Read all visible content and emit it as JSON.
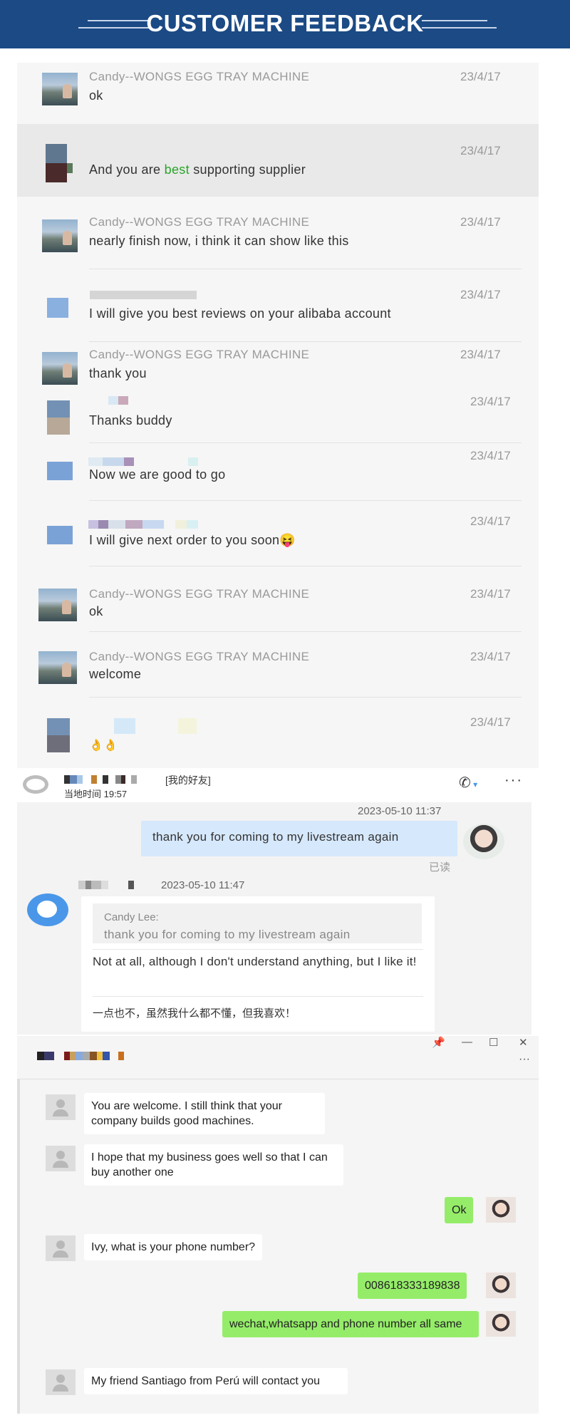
{
  "banner": {
    "title": "CUSTOMER FEEDBACK"
  },
  "history": {
    "messages": [
      {
        "sender": "Candy--WONGS EGG TRAY MACHINE",
        "text": "ok",
        "date": "23/4/17"
      },
      {
        "sender": "",
        "text_before": "And you are ",
        "text_highlight": "best",
        "text_after": " supporting supplier",
        "date": "23/4/17"
      },
      {
        "sender": "Candy--WONGS EGG TRAY MACHINE",
        "text": "nearly finish now, i think it can show like this",
        "date": "23/4/17"
      },
      {
        "sender": "",
        "text": "I will give you best reviews on your alibaba account",
        "date": "23/4/17"
      },
      {
        "sender": "Candy--WONGS EGG TRAY MACHINE",
        "text": "thank you",
        "date": "23/4/17"
      },
      {
        "sender": "",
        "text": "Thanks buddy",
        "date": "23/4/17"
      },
      {
        "sender": "",
        "text": "Now we are good to go",
        "date": "23/4/17"
      },
      {
        "sender": "",
        "text": "I will give next order to you soon",
        "emoji": "😝",
        "date": "23/4/17"
      },
      {
        "sender": "Candy--WONGS EGG TRAY MACHINE",
        "text": "ok",
        "date": "23/4/17"
      },
      {
        "sender": "Candy--WONGS EGG TRAY MACHINE",
        "text": "welcome",
        "date": "23/4/17"
      },
      {
        "sender": "",
        "text": "👌👌",
        "date": "23/4/17"
      }
    ]
  },
  "livestream": {
    "friend_tag": "[我的好友]",
    "local_time": "当地时间 19:57",
    "timestamp_1": "2023-05-10 11:37",
    "sent_text": "thank you for coming to my livestream again",
    "read_status": "已读",
    "timestamp_2": "2023-05-10 11:47",
    "quote_name": "Candy Lee:",
    "quote_text": "thank you for coming to my livestream again",
    "reply_text": "Not at all, although I don't understand anything, but I like it!",
    "reply_translation": "一点也不，虽然我什么都不懂，但我喜欢！",
    "icons": [
      "phone-icon",
      "more-icon"
    ]
  },
  "wechat": {
    "window_controls": [
      "📌",
      "—",
      "☐",
      "✕",
      "···"
    ],
    "messages": [
      {
        "side": "left",
        "text": "You are welcome. I still think that your company builds good machines."
      },
      {
        "side": "left",
        "text": "I hope that my business goes well so that I can buy another one"
      },
      {
        "side": "right",
        "text": "Ok"
      },
      {
        "side": "left",
        "text": "Ivy, what is your phone number?"
      },
      {
        "side": "right",
        "text": "008618333189838"
      },
      {
        "side": "right",
        "text": "wechat,whatsapp and phone number  all same"
      },
      {
        "side": "left",
        "text": "My friend Santiago from Perú will contact you"
      }
    ],
    "colors": {
      "sent_bubble": "#95ec69",
      "received_bubble": "#ffffff"
    }
  },
  "colors": {
    "banner": "#1b4a85",
    "highlight": "#2aa52a",
    "sent_livestream": "#d6e8fb"
  }
}
